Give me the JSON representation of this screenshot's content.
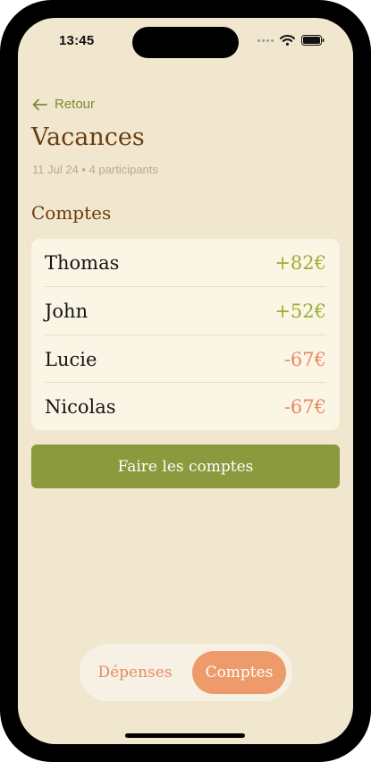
{
  "status": {
    "time": "13:45"
  },
  "nav": {
    "back_label": "Retour"
  },
  "page": {
    "title": "Vacances",
    "meta": "11 Jul 24 • 4 participants"
  },
  "section": {
    "title": "Comptes"
  },
  "accounts": [
    {
      "name": "Thomas",
      "amount": "+82€",
      "status": "positive"
    },
    {
      "name": "John",
      "amount": "+52€",
      "status": "positive"
    },
    {
      "name": "Lucie",
      "amount": "-67€",
      "status": "negative"
    },
    {
      "name": "Nicolas",
      "amount": "-67€",
      "status": "negative"
    }
  ],
  "cta": {
    "label": "Faire les comptes"
  },
  "tabs": [
    {
      "label": "Dépenses",
      "active": false
    },
    {
      "label": "Comptes",
      "active": true
    }
  ],
  "colors": {
    "background": "#f1e7cf",
    "accent_green": "#8a9a3d",
    "positive": "#9aae35",
    "negative": "#e98a61",
    "title_brown": "#6b3d0d",
    "tab_active": "#ee9b6b"
  },
  "icons": {
    "back": "arrow-left-icon",
    "signal": "signal-dots-icon",
    "wifi": "wifi-icon",
    "battery": "battery-icon"
  }
}
